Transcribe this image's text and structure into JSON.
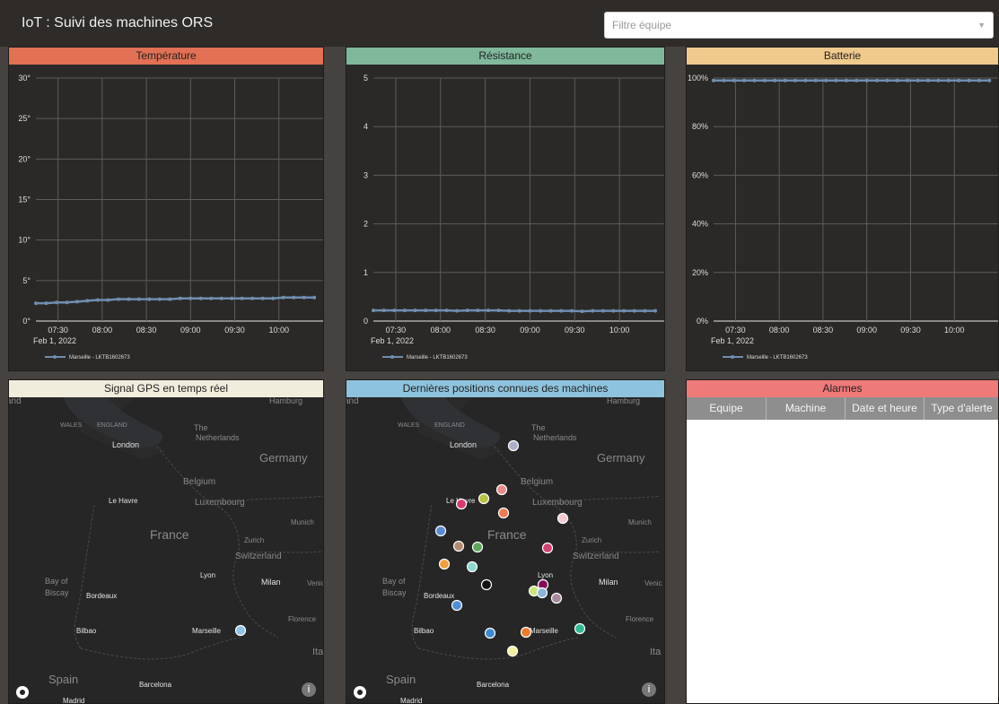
{
  "header": {
    "title": "IoT : Suivi des machines ORS",
    "filter_placeholder": "Filtre équipe"
  },
  "panels": {
    "temperature": {
      "title": "Température",
      "color": "#e17055"
    },
    "resistance": {
      "title": "Résistance",
      "color": "#7fb89b"
    },
    "battery": {
      "title": "Batterie",
      "color": "#f0c98c"
    },
    "gps": {
      "title": "Signal GPS en temps réel",
      "color": "#f1eddc"
    },
    "positions": {
      "title": "Dernières positions connues des machines",
      "color": "#8ec3dd"
    },
    "alarms": {
      "title": "Alarmes",
      "color": "#ef7a7a"
    }
  },
  "alarms": {
    "columns": [
      "Equipe",
      "Machine",
      "Date et heure",
      "Type d'alerte"
    ]
  },
  "chart_data": [
    {
      "type": "line",
      "title": "Température",
      "x": [
        "07:15",
        "07:22",
        "07:29",
        "07:36",
        "07:43",
        "07:50",
        "07:57",
        "08:04",
        "08:11",
        "08:18",
        "08:25",
        "08:32",
        "08:39",
        "08:46",
        "08:53",
        "09:00",
        "09:07",
        "09:14",
        "09:21",
        "09:28",
        "09:35",
        "09:42",
        "09:49",
        "09:56",
        "10:03",
        "10:10",
        "10:17",
        "10:24"
      ],
      "xticks": [
        "07:30",
        "08:00",
        "08:30",
        "09:00",
        "09:30",
        "10:00"
      ],
      "xdate": "Feb 1, 2022",
      "yticks": [
        "0°",
        "5°",
        "10°",
        "15°",
        "20°",
        "25°",
        "30°"
      ],
      "ylim": [
        0,
        30
      ],
      "series": [
        {
          "name": "Marseille - LKTB1602673",
          "color": "#6f8fb0",
          "values": [
            2.2,
            2.2,
            2.3,
            2.3,
            2.4,
            2.5,
            2.6,
            2.6,
            2.7,
            2.7,
            2.7,
            2.7,
            2.7,
            2.7,
            2.8,
            2.8,
            2.8,
            2.8,
            2.8,
            2.8,
            2.8,
            2.8,
            2.8,
            2.8,
            2.9,
            2.9,
            2.9,
            2.9
          ]
        }
      ]
    },
    {
      "type": "line",
      "title": "Résistance",
      "x": [
        "07:15",
        "07:22",
        "07:29",
        "07:36",
        "07:43",
        "07:50",
        "07:57",
        "08:04",
        "08:11",
        "08:18",
        "08:25",
        "08:32",
        "08:39",
        "08:46",
        "08:53",
        "09:00",
        "09:07",
        "09:14",
        "09:21",
        "09:28",
        "09:35",
        "09:42",
        "09:49",
        "09:56",
        "10:03",
        "10:10",
        "10:17",
        "10:24"
      ],
      "xticks": [
        "07:30",
        "08:00",
        "08:30",
        "09:00",
        "09:30",
        "10:00"
      ],
      "xdate": "Feb 1, 2022",
      "yticks": [
        "0",
        "1",
        "2",
        "3",
        "4",
        "5"
      ],
      "ylim": [
        0,
        5
      ],
      "series": [
        {
          "name": "Marseille - LKTB1602673",
          "color": "#6f8fb0",
          "values": [
            0.22,
            0.22,
            0.22,
            0.22,
            0.22,
            0.22,
            0.22,
            0.22,
            0.21,
            0.22,
            0.22,
            0.22,
            0.22,
            0.21,
            0.21,
            0.21,
            0.21,
            0.21,
            0.21,
            0.21,
            0.2,
            0.21,
            0.21,
            0.21,
            0.21,
            0.21,
            0.21,
            0.21
          ]
        }
      ]
    },
    {
      "type": "line",
      "title": "Batterie",
      "x": [
        "07:15",
        "07:22",
        "07:29",
        "07:36",
        "07:43",
        "07:50",
        "07:57",
        "08:04",
        "08:11",
        "08:18",
        "08:25",
        "08:32",
        "08:39",
        "08:46",
        "08:53",
        "09:00",
        "09:07",
        "09:14",
        "09:21",
        "09:28",
        "09:35",
        "09:42",
        "09:49",
        "09:56",
        "10:03",
        "10:10",
        "10:17",
        "10:24"
      ],
      "xticks": [
        "07:30",
        "08:00",
        "08:30",
        "09:00",
        "09:30",
        "10:00"
      ],
      "xdate": "Feb 1, 2022",
      "yticks": [
        "0%",
        "20%",
        "40%",
        "60%",
        "80%",
        "100%"
      ],
      "ylim": [
        0,
        100
      ],
      "series": [
        {
          "name": "Marseille - LKTB1602673",
          "color": "#6f8fb0",
          "values": [
            99,
            99,
            99,
            99,
            99,
            99,
            99,
            99,
            99,
            99,
            99,
            99,
            99,
            99,
            99,
            99,
            99,
            99,
            99,
            99,
            99,
            99,
            99,
            99,
            99,
            99,
            99,
            99
          ]
        }
      ]
    }
  ],
  "map_labels": [
    "Hamburg",
    "WALES",
    "ENGLAND",
    "The",
    "Netherlands",
    "London",
    "Germany",
    "Belgium",
    "Luxembourg",
    "Le Havre",
    "France",
    "Munich",
    "Zurich",
    "Switzerland",
    "Lyon",
    "Milan",
    "Bay of",
    "Biscay",
    "Bordeaux",
    "Florence",
    "Bilbao",
    "Marseille",
    "Spain",
    "Barcelona",
    "Ita",
    "and",
    "Venic",
    "Madrid"
  ],
  "gps_markers": [
    {
      "color": "#8ec3e8"
    }
  ],
  "position_markers": [
    {
      "color": "#aab0c8"
    },
    {
      "color": "#e98b8b"
    },
    {
      "color": "#b7c341"
    },
    {
      "color": "#d83b6a"
    },
    {
      "color": "#ee7b56"
    },
    {
      "color": "#f4c9cf"
    },
    {
      "color": "#5b8bd2"
    },
    {
      "color": "#b68c70"
    },
    {
      "color": "#5da65a"
    },
    {
      "color": "#d54172"
    },
    {
      "color": "#f0a03c"
    },
    {
      "color": "#8fd8cc"
    },
    {
      "color": "#111111"
    },
    {
      "color": "#84095a"
    },
    {
      "color": "#cbe67a"
    },
    {
      "color": "#8ab6d8"
    },
    {
      "color": "#a9889e"
    },
    {
      "color": "#4e8fd3"
    },
    {
      "color": "#3f89d2"
    },
    {
      "color": "#f07a2a"
    },
    {
      "color": "#2fba96"
    },
    {
      "color": "#f5f0a0"
    }
  ]
}
